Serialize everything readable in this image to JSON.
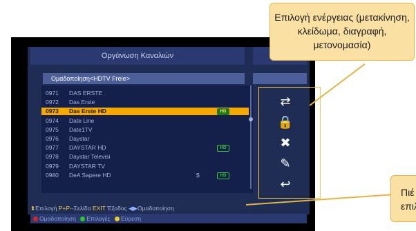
{
  "screen": {
    "title": "Οργάνωση Καναλιών",
    "group_label": "Ομαδοποίηση<HDTV Freie>"
  },
  "channels": [
    {
      "num": "0971",
      "name": "DAS ERSTE",
      "hd": false,
      "pay": false,
      "selected": false
    },
    {
      "num": "0972",
      "name": "Das Erste",
      "hd": false,
      "pay": false,
      "selected": false
    },
    {
      "num": "0973",
      "name": "Das Erste HD",
      "hd": true,
      "pay": false,
      "selected": true
    },
    {
      "num": "0974",
      "name": "Date Line",
      "hd": false,
      "pay": false,
      "selected": false
    },
    {
      "num": "0975",
      "name": "Date1TV",
      "hd": false,
      "pay": false,
      "selected": false
    },
    {
      "num": "0976",
      "name": "Daystar",
      "hd": false,
      "pay": false,
      "selected": false
    },
    {
      "num": "0977",
      "name": "DAYSTAR HD",
      "hd": true,
      "pay": false,
      "selected": false
    },
    {
      "num": "0978",
      "name": "Daystar Televisi",
      "hd": false,
      "pay": false,
      "selected": false
    },
    {
      "num": "0979",
      "name": "DAYSTAR TV",
      "hd": false,
      "pay": false,
      "selected": false
    },
    {
      "num": "0980",
      "name": "DeA Sapere HD",
      "hd": true,
      "pay": true,
      "selected": false
    }
  ],
  "hd_badge": "HD",
  "pay_symbol": "$",
  "actions": [
    {
      "name": "move-icon",
      "glyph": "⇄"
    },
    {
      "name": "lock-icon",
      "glyph": "🔒"
    },
    {
      "name": "delete-icon",
      "glyph": "✖"
    },
    {
      "name": "rename-icon",
      "glyph": "✎"
    },
    {
      "name": "back-icon",
      "glyph": "↩"
    }
  ],
  "help": {
    "select": "Επιλογή",
    "page_keys": "P+P-",
    "page": "Σελίδα",
    "exit_key": "EXIT",
    "exit": "Έξοδος",
    "group": "Ομαδοποίηση"
  },
  "bottom_bar": {
    "red": "Ομαδοποίηση",
    "green": "Επιλογές",
    "yellow": "Εύρεση"
  },
  "callouts": {
    "actions": "Επιλογή ενέργειας (μετακίνηση, κλείδωμα, διαγραφή, μετονομασία)",
    "keys_line1": "Πιέ",
    "keys_line2": "επιλογ"
  },
  "colors": {
    "highlight": "#f5a800",
    "callout_bg": "#fbe0a4",
    "callout_border": "#e5b443",
    "red": "#d22",
    "green": "#2c2",
    "yellow": "#ec2"
  }
}
